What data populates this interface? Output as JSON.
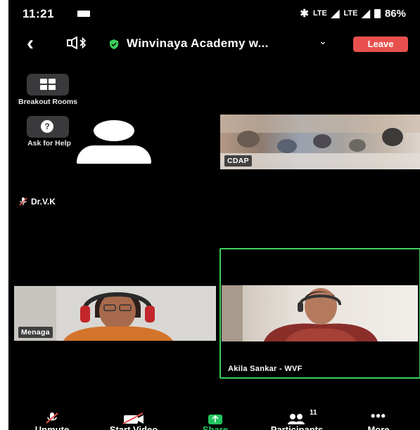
{
  "status_bar": {
    "time": "11:21",
    "signal_text": "LTE",
    "battery": "86%"
  },
  "top_bar": {
    "meeting_title": "Winvinaya Academy w...",
    "leave_label": "Leave"
  },
  "tools": {
    "breakout_label": "Breakout Rooms",
    "help_label": "Ask for Help",
    "help_glyph": "?"
  },
  "participants": {
    "audio_user": "Dr.V.K",
    "tile_1": "CDAP",
    "tile_2": "Menaga",
    "tile_3": "Akila Sankar - WVF"
  },
  "toolbar": {
    "unmute": "Unmute",
    "start_video": "Start Video",
    "share": "Share",
    "participants": "Participants",
    "participants_count": "11",
    "more": "More"
  },
  "colors": {
    "leave": "#e8504d",
    "active_speaker": "#3ccf5b",
    "share": "#22c55e",
    "mute_slash": "#e8504d"
  }
}
